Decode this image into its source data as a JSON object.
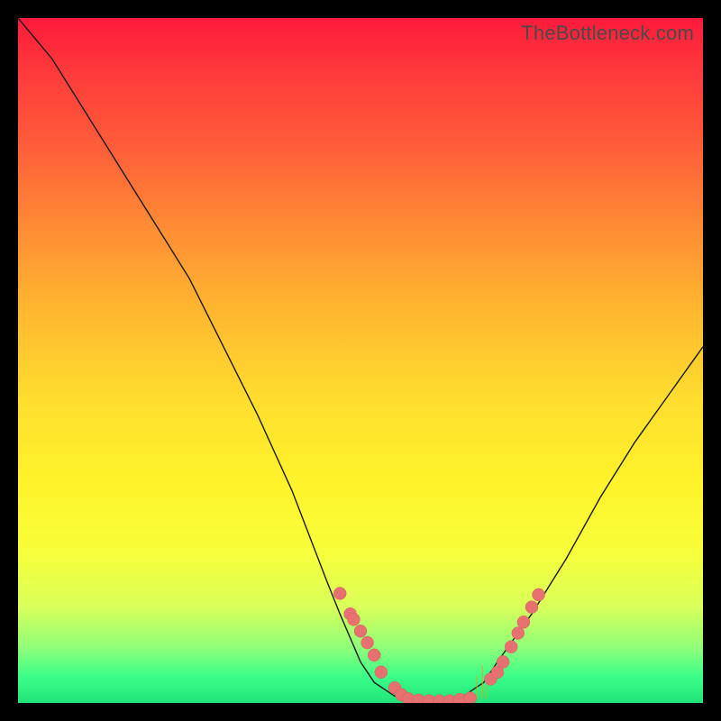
{
  "watermark": "TheBottleneck.com",
  "colors": {
    "gradient_top": "#ff1a3c",
    "gradient_bottom": "#20e47a",
    "curve": "#1a1a1a",
    "dot": "#e77070",
    "frame": "#000000"
  },
  "chart_data": {
    "type": "line",
    "title": "",
    "xlabel": "",
    "ylabel": "",
    "xlim": [
      0,
      100
    ],
    "ylim": [
      0,
      100
    ],
    "series": [
      {
        "name": "bottleneck-curve",
        "x": [
          0,
          5,
          10,
          15,
          20,
          25,
          30,
          35,
          40,
          45,
          47,
          50,
          52,
          55,
          58,
          60,
          62,
          65,
          68,
          70,
          75,
          80,
          85,
          90,
          95,
          100
        ],
        "y": [
          100,
          94,
          86,
          78,
          70,
          62,
          52,
          42,
          31,
          18,
          13,
          6,
          3,
          1,
          0,
          0,
          0,
          1,
          3,
          6,
          13,
          21,
          30,
          38,
          45,
          52
        ]
      }
    ],
    "markers_left": [
      {
        "x": 47,
        "y": 16
      },
      {
        "x": 48.5,
        "y": 13
      },
      {
        "x": 49,
        "y": 12.2
      },
      {
        "x": 50,
        "y": 10.5
      },
      {
        "x": 51,
        "y": 8.8
      },
      {
        "x": 52,
        "y": 7
      },
      {
        "x": 53,
        "y": 4.5
      },
      {
        "x": 55,
        "y": 2.2
      },
      {
        "x": 56,
        "y": 1.2
      }
    ],
    "markers_bottom": [
      {
        "x": 57,
        "y": 0.6
      },
      {
        "x": 58.5,
        "y": 0.4
      },
      {
        "x": 60,
        "y": 0.3
      },
      {
        "x": 61.5,
        "y": 0.3
      },
      {
        "x": 63,
        "y": 0.3
      },
      {
        "x": 64.5,
        "y": 0.5
      },
      {
        "x": 66,
        "y": 0.7
      }
    ],
    "markers_right": [
      {
        "x": 69,
        "y": 3.5
      },
      {
        "x": 70,
        "y": 4.5
      },
      {
        "x": 70.8,
        "y": 6.0
      },
      {
        "x": 72,
        "y": 8.2
      },
      {
        "x": 73,
        "y": 10.2
      },
      {
        "x": 73.8,
        "y": 11.8
      },
      {
        "x": 75,
        "y": 14.0
      },
      {
        "x": 76,
        "y": 15.8
      }
    ],
    "spikes": [
      {
        "x": 67.0,
        "h": 4.0
      },
      {
        "x": 67.8,
        "h": 5.5
      },
      {
        "x": 68.4,
        "h": 3.8
      }
    ]
  }
}
